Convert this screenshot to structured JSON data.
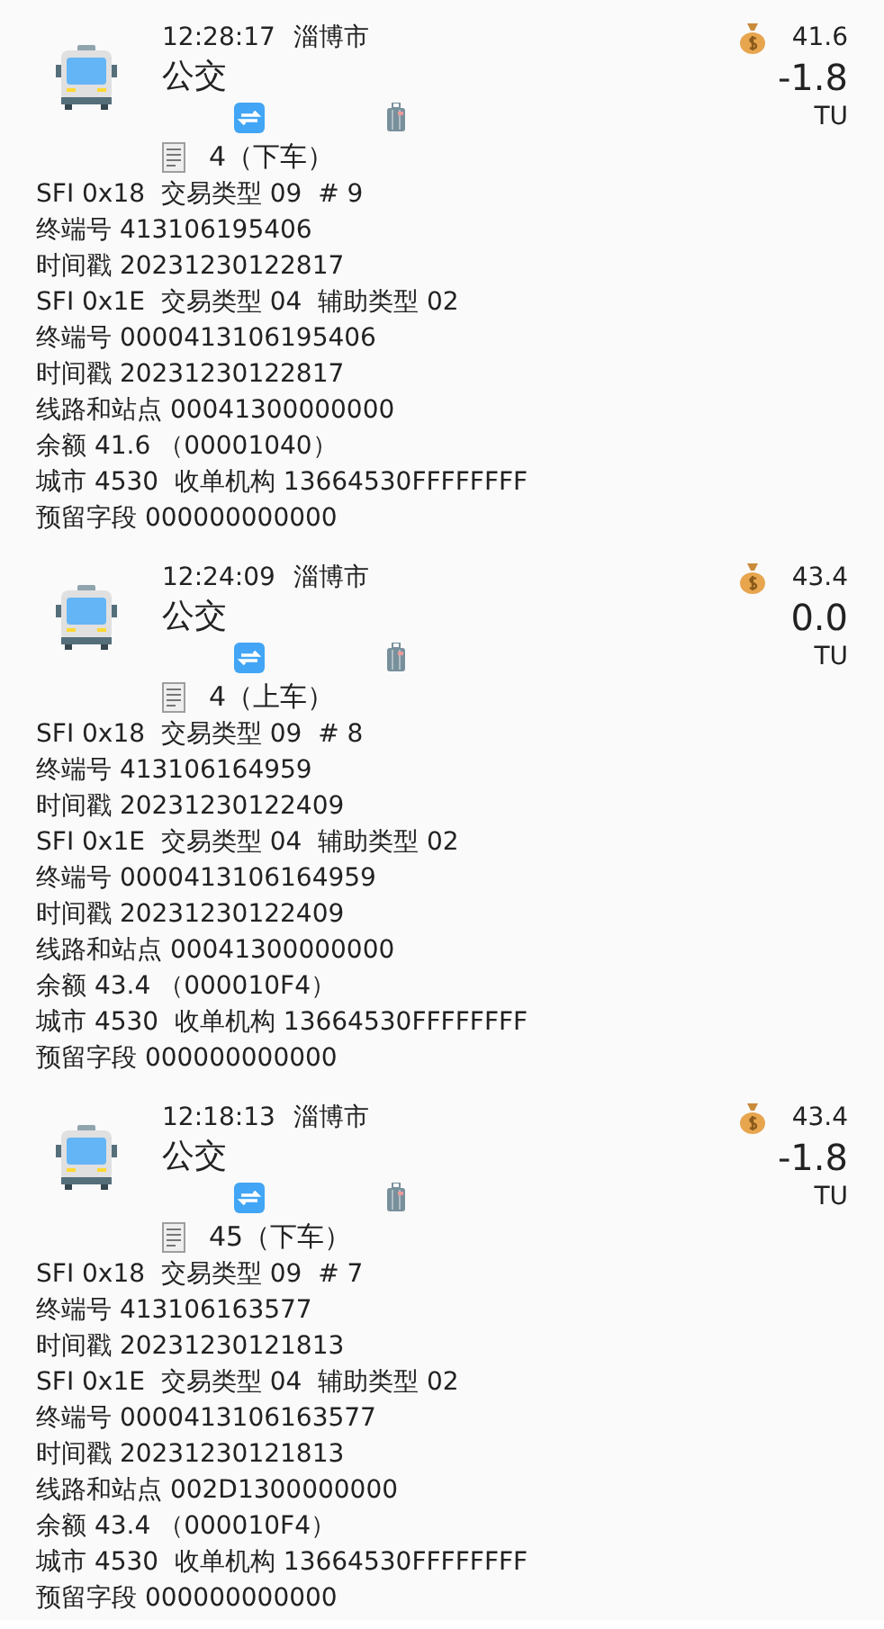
{
  "records": [
    {
      "time": "12:28:17",
      "city": "淄博市",
      "type": "公交",
      "balance": "41.6",
      "amount": "-1.8",
      "unit": "TU",
      "ticket": "4（下车）",
      "details": [
        "SFI 0x18  交易类型 09  # 9",
        "终端号 413106195406",
        "时间戳 20231230122817",
        "SFI 0x1E  交易类型 04  辅助类型 02",
        "终端号 0000413106195406",
        "时间戳 20231230122817",
        "线路和站点 00041300000000",
        "余额 41.6 （00001040）",
        "城市 4530  收单机构 13664530FFFFFFFF",
        "预留字段 000000000000"
      ]
    },
    {
      "time": "12:24:09",
      "city": "淄博市",
      "type": "公交",
      "balance": "43.4",
      "amount": "0.0",
      "unit": "TU",
      "ticket": "4（上车）",
      "details": [
        "SFI 0x18  交易类型 09  # 8",
        "终端号 413106164959",
        "时间戳 20231230122409",
        "SFI 0x1E  交易类型 04  辅助类型 02",
        "终端号 0000413106164959",
        "时间戳 20231230122409",
        "线路和站点 00041300000000",
        "余额 43.4 （000010F4）",
        "城市 4530  收单机构 13664530FFFFFFFF",
        "预留字段 000000000000"
      ]
    },
    {
      "time": "12:18:13",
      "city": "淄博市",
      "type": "公交",
      "balance": "43.4",
      "amount": "-1.8",
      "unit": "TU",
      "ticket": "45（下车）",
      "details": [
        "SFI 0x18  交易类型 09  # 7",
        "终端号 413106163577",
        "时间戳 20231230121813",
        "SFI 0x1E  交易类型 04  辅助类型 02",
        "终端号 0000413106163577",
        "时间戳 20231230121813",
        "线路和站点 002D1300000000",
        "余额 43.4 （000010F4）",
        "城市 4530  收单机构 13664530FFFFFFFF",
        "预留字段 000000000000"
      ]
    }
  ]
}
